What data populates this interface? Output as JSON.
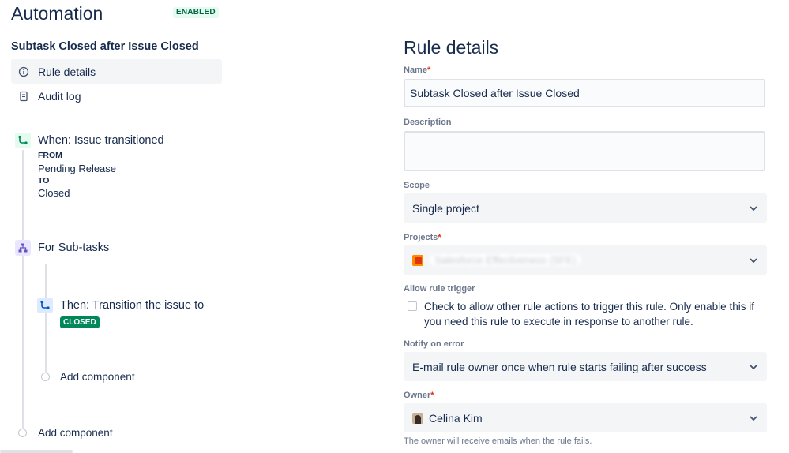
{
  "header": {
    "title": "Automation",
    "status": "ENABLED"
  },
  "sidebar": {
    "rule_name": "Subtask Closed after Issue Closed",
    "nav": [
      {
        "label": "Rule details",
        "icon": "info-icon",
        "selected": true
      },
      {
        "label": "Audit log",
        "icon": "document-icon",
        "selected": false
      }
    ]
  },
  "flow": {
    "trigger": {
      "title": "When: Issue transitioned",
      "from_label": "FROM",
      "from_value": "Pending Release",
      "to_label": "TO",
      "to_value": "Closed"
    },
    "branch": {
      "title": "For Sub-tasks"
    },
    "action": {
      "title": "Then: Transition the issue to",
      "status": "CLOSED"
    },
    "add_component_inner": "Add component",
    "add_component_outer": "Add component"
  },
  "details": {
    "title": "Rule details",
    "name_label": "Name",
    "name_value": "Subtask Closed after Issue Closed",
    "description_label": "Description",
    "description_value": "",
    "scope_label": "Scope",
    "scope_value": "Single project",
    "projects_label": "Projects",
    "projects_value": "Salesforce Effectiveness (SFE)",
    "allow_trigger_label": "Allow rule trigger",
    "allow_trigger_text": "Check to allow other rule actions to trigger this rule. Only enable this if you need this rule to execute in response to another rule.",
    "allow_trigger_checked": false,
    "notify_label": "Notify on error",
    "notify_value": "E-mail rule owner once when rule starts failing after success",
    "owner_label": "Owner",
    "owner_value": "Celina Kim",
    "owner_help": "The owner will receive emails when the rule fails.",
    "required_mark": "*"
  },
  "colors": {
    "enabled_bg": "#e3fcef",
    "enabled_text": "#006644",
    "closed_bg": "#00875a",
    "required": "#de350b"
  }
}
